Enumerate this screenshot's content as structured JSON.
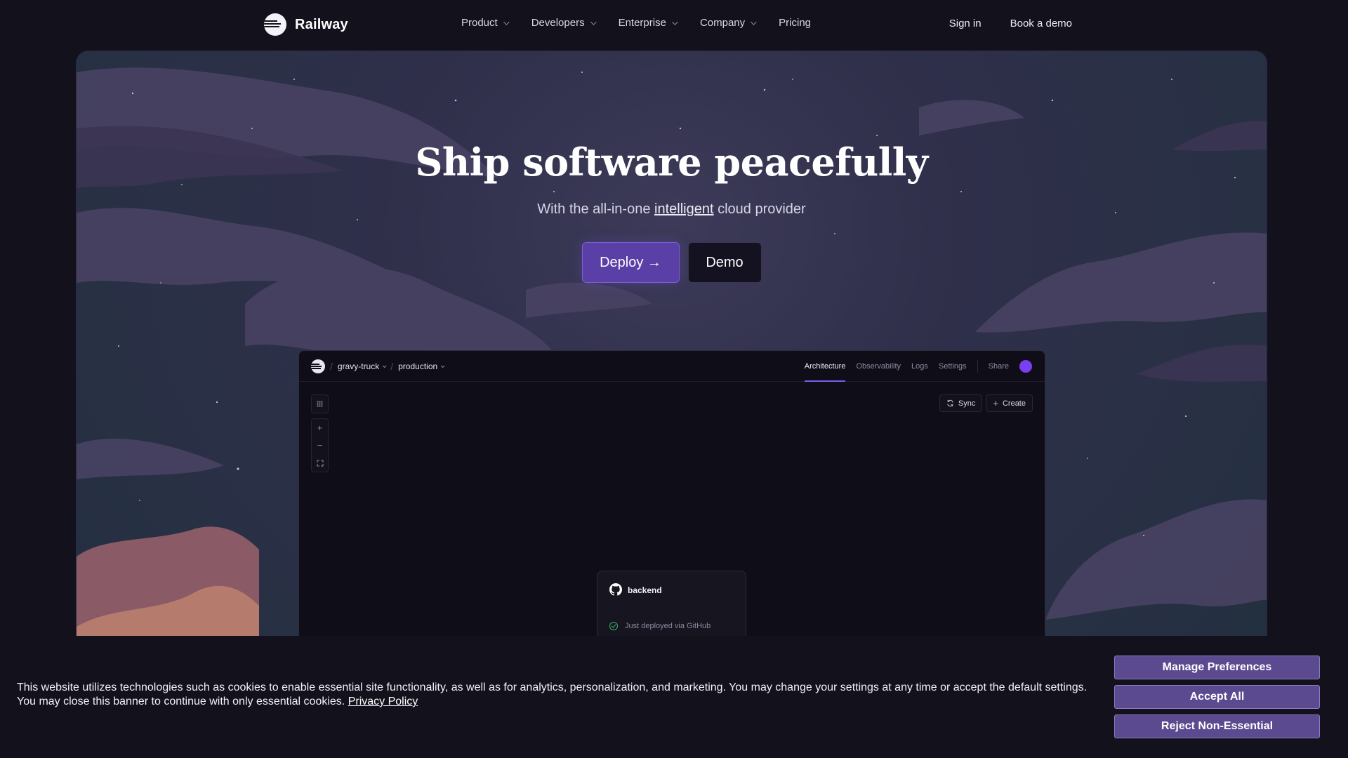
{
  "nav": {
    "brand": "Railway",
    "links": [
      {
        "label": "Product",
        "has_dropdown": true
      },
      {
        "label": "Developers",
        "has_dropdown": true
      },
      {
        "label": "Enterprise",
        "has_dropdown": true
      },
      {
        "label": "Company",
        "has_dropdown": true
      },
      {
        "label": "Pricing",
        "has_dropdown": false
      }
    ],
    "sign_in": "Sign in",
    "book_demo": "Book a demo"
  },
  "hero": {
    "title": "Ship software peacefully",
    "subtitle_before": "With the all-in-one ",
    "subtitle_link": "intelligent",
    "subtitle_after": " cloud provider",
    "deploy_label": "Deploy →",
    "demo_label": "Demo"
  },
  "app": {
    "project": "gravy-truck",
    "environment": "production",
    "tabs": [
      "Architecture",
      "Observability",
      "Logs",
      "Settings"
    ],
    "active_tab": "Architecture",
    "share_label": "Share",
    "sync_label": "Sync",
    "create_label": "Create",
    "zoom_in": "+",
    "zoom_out": "−",
    "service": {
      "name": "backend",
      "status": "Just deployed via GitHub"
    },
    "avatar_color": "#7b3ff2"
  },
  "cookie": {
    "text": "This website utilizes technologies such as cookies to enable essential site functionality, as well as for analytics, personalization, and marketing. You may change your settings at any time or accept the default settings. You may close this banner to continue with only essential cookies.",
    "privacy_link": "Privacy Policy",
    "manage": "Manage Preferences",
    "accept": "Accept All",
    "reject": "Reject Non-Essential"
  },
  "colors": {
    "background": "#13111c",
    "accent": "#5a3fa6",
    "cookie_button": "#5b4a8f",
    "status_ok": "#3bb36c"
  }
}
